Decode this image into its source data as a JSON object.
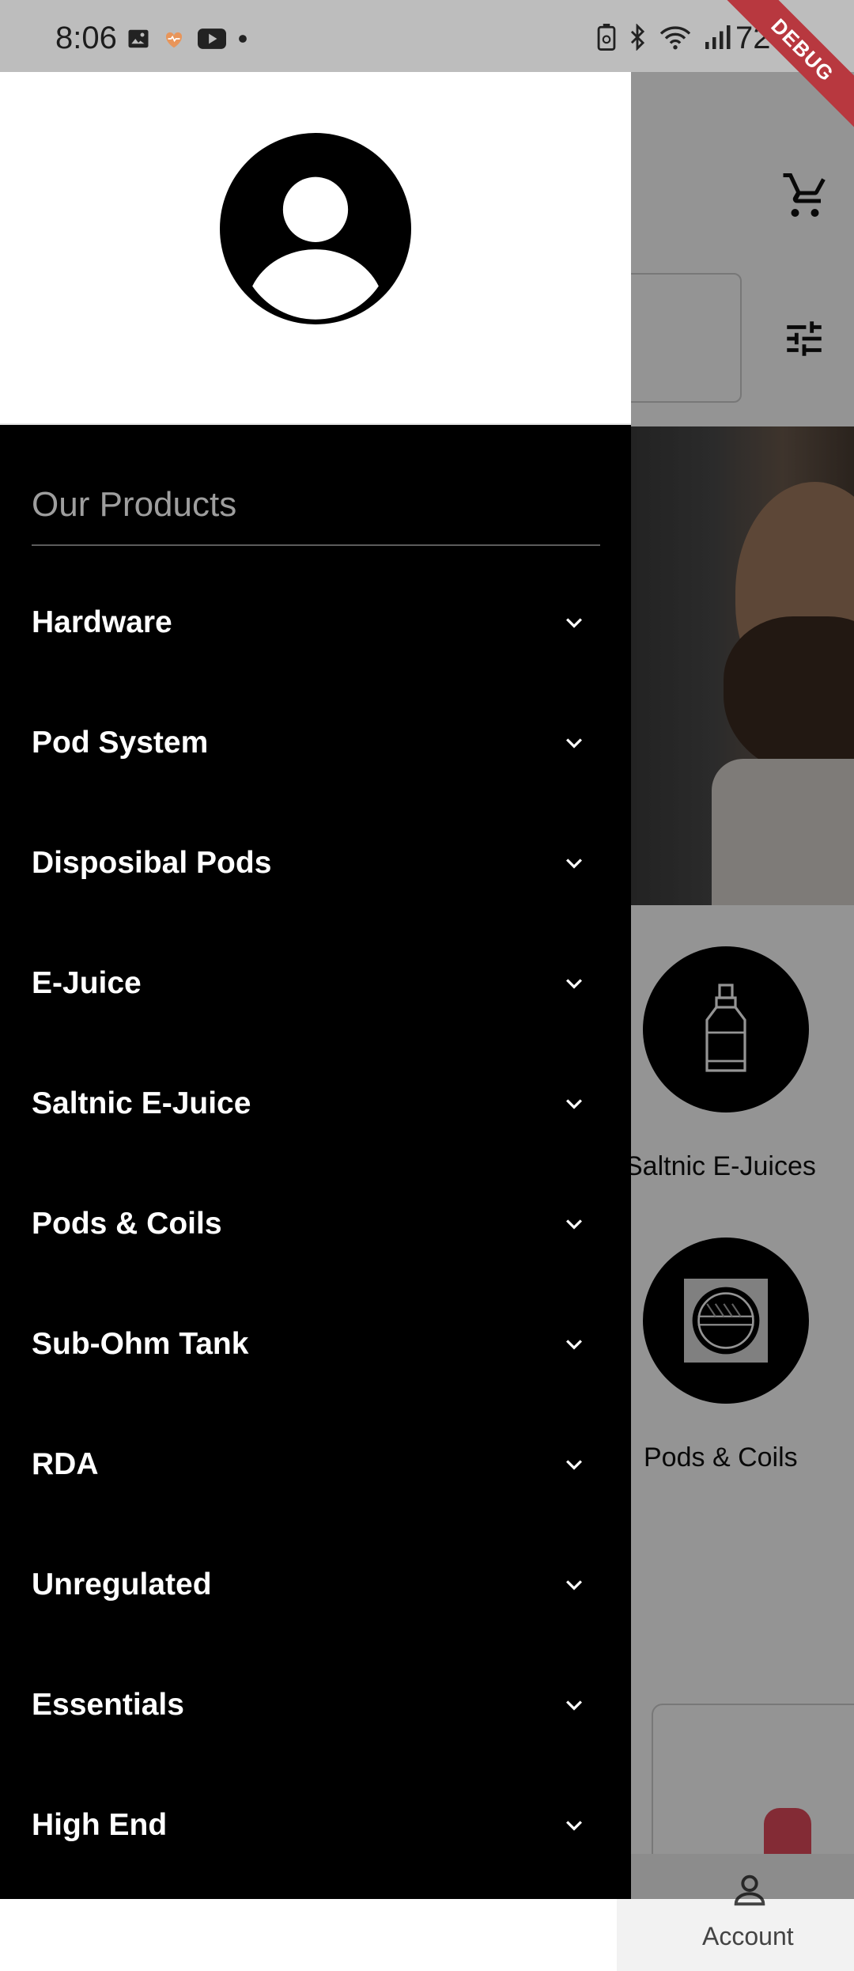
{
  "status_bar": {
    "time": "8:06",
    "battery": "72%",
    "icons_left": [
      "gallery-icon",
      "health-icon",
      "youtube-icon",
      "dot-icon"
    ],
    "icons_right": [
      "battery-saver-icon",
      "bluetooth-icon",
      "wifi-icon",
      "signal-icon"
    ]
  },
  "debug_banner": "DEBUG",
  "background_app": {
    "categories": [
      {
        "label": "Saltnic E-Juices",
        "icon": "bottle-icon"
      },
      {
        "label": "Pods & Coils",
        "icon": "coil-icon"
      }
    ],
    "bottom_nav": {
      "account_label": "Account"
    }
  },
  "drawer": {
    "section_title": "Our Products",
    "items": [
      {
        "label": "Hardware"
      },
      {
        "label": "Pod System"
      },
      {
        "label": "Disposibal Pods"
      },
      {
        "label": "E-Juice"
      },
      {
        "label": "Saltnic E-Juice"
      },
      {
        "label": "Pods & Coils"
      },
      {
        "label": "Sub-Ohm Tank"
      },
      {
        "label": "RDA"
      },
      {
        "label": "Unregulated"
      },
      {
        "label": "Essentials"
      },
      {
        "label": "High End"
      }
    ]
  },
  "colors": {
    "drawer_bg": "#000000",
    "header_bg": "#ffffff",
    "section_title": "#9e9e9e",
    "menu_text": "#ffffff",
    "debug_banner": "#b8383f"
  }
}
